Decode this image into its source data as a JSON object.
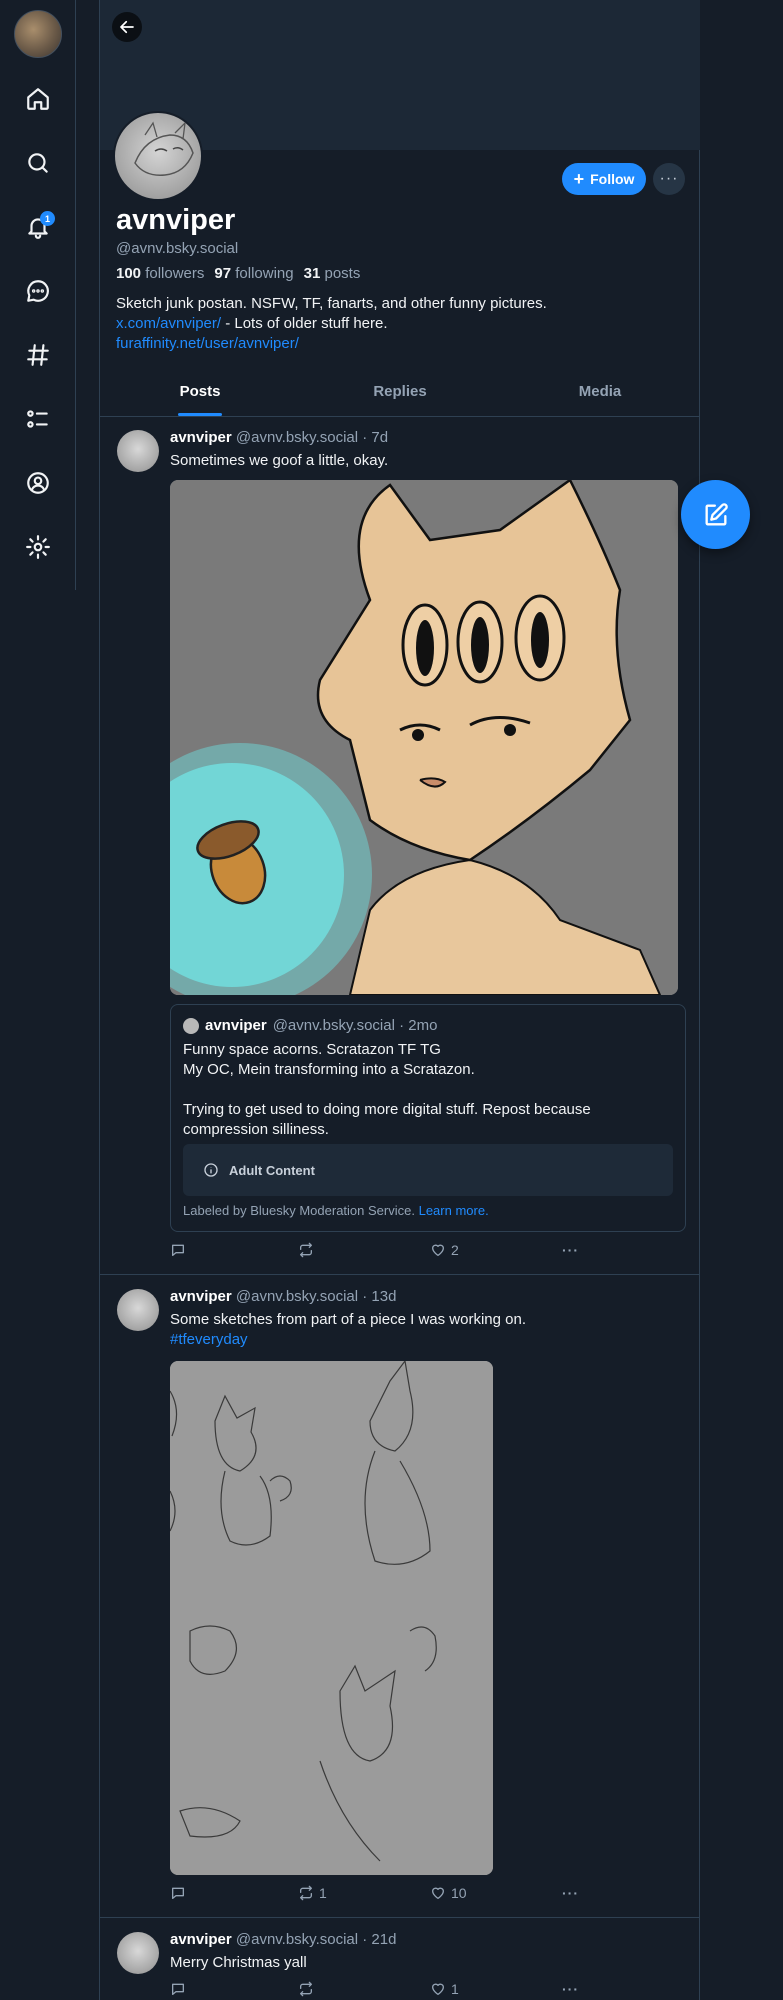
{
  "nav": {
    "notifications_badge": "1",
    "items": [
      "home-icon",
      "search-icon",
      "bell-icon",
      "chat-icon",
      "hashtag-icon",
      "list-icon",
      "profile-icon",
      "settings-icon"
    ]
  },
  "profile": {
    "display_name": "avnviper",
    "handle": "@avnv.bsky.social",
    "followers_count": "100",
    "followers_label": "followers",
    "following_count": "97",
    "following_label": "following",
    "posts_count": "31",
    "posts_label": "posts",
    "bio_line1": "Sketch junk postan. NSFW, TF, fanarts, and other funny pictures.",
    "bio_link1": "x.com/avnviper/",
    "bio_line2_rest": " - Lots of older stuff here.",
    "bio_link2": "furaffinity.net/user/avnviper/",
    "follow_label": "Follow"
  },
  "tabs": [
    {
      "label": "Posts",
      "active": true
    },
    {
      "label": "Replies",
      "active": false
    },
    {
      "label": "Media",
      "active": false
    }
  ],
  "posts": [
    {
      "author": "avnviper",
      "meta": "@avnv.bsky.social · 7d",
      "text": "Sometimes we goof a little, okay.",
      "quote": {
        "author": "avnviper",
        "meta": "@avnv.bsky.social · 2mo",
        "text": "Funny space acorns. Scratazon TF TG\nMy OC, Mein transforming into a Scratazon.\n\nTrying to get used to doing more digital stuff. Repost because compression silliness.",
        "warning": "Adult Content",
        "labeled_by": "Labeled by Bluesky Moderation Service.",
        "learn_more": "Learn more."
      },
      "reposts": "",
      "likes": "2"
    },
    {
      "author": "avnviper",
      "meta": "@avnv.bsky.social · 13d",
      "text": "Some sketches from part of a piece I was working on.",
      "hashtag": "#tfeveryday",
      "reposts": "1",
      "likes": "10"
    },
    {
      "author": "avnviper",
      "meta": "@avnv.bsky.social · 21d",
      "text": "Merry Christmas yall",
      "reposts": "",
      "likes": "1"
    }
  ]
}
